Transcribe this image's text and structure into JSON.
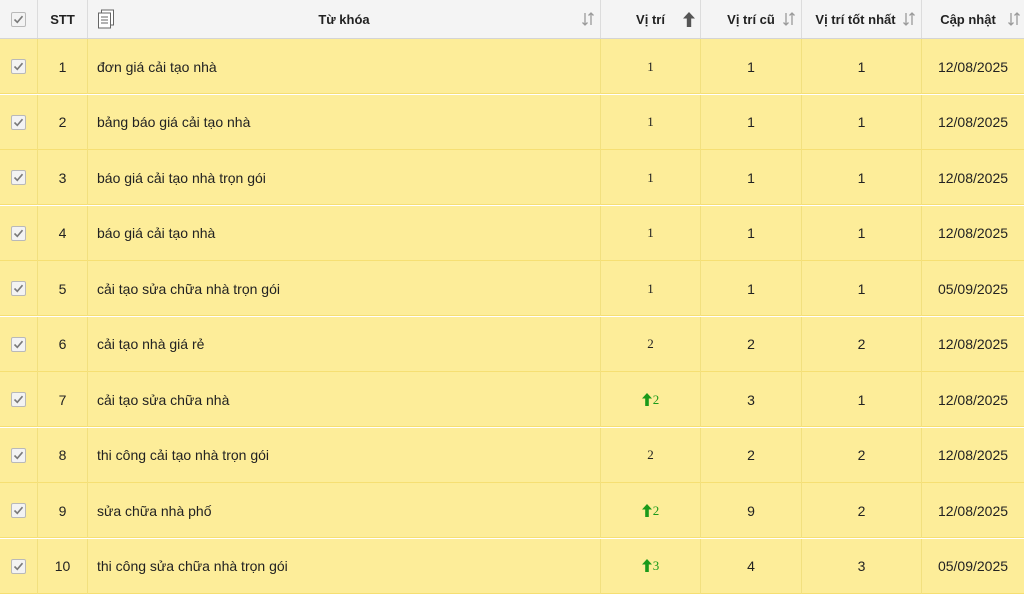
{
  "header": {
    "stt": "STT",
    "keyword": "Từ khóa",
    "position": "Vị trí",
    "old_position": "Vị trí cũ",
    "best_position": "Vị trí tốt nhất",
    "updated": "Cập nhật"
  },
  "rows": [
    {
      "stt": "1",
      "keyword": "đơn giá cải tạo nhà",
      "position": "1",
      "trend": "",
      "old": "1",
      "best": "1",
      "updated": "12/08/2025"
    },
    {
      "stt": "2",
      "keyword": "bảng báo giá cải tạo nhà",
      "position": "1",
      "trend": "",
      "old": "1",
      "best": "1",
      "updated": "12/08/2025"
    },
    {
      "stt": "3",
      "keyword": "báo giá cải tạo nhà trọn gói",
      "position": "1",
      "trend": "",
      "old": "1",
      "best": "1",
      "updated": "12/08/2025"
    },
    {
      "stt": "4",
      "keyword": "báo giá cải tạo nhà",
      "position": "1",
      "trend": "",
      "old": "1",
      "best": "1",
      "updated": "12/08/2025"
    },
    {
      "stt": "5",
      "keyword": "cải tạo sửa chữa nhà trọn gói",
      "position": "1",
      "trend": "",
      "old": "1",
      "best": "1",
      "updated": "05/09/2025"
    },
    {
      "stt": "6",
      "keyword": "cải tạo nhà giá rẻ",
      "position": "2",
      "trend": "",
      "old": "2",
      "best": "2",
      "updated": "12/08/2025"
    },
    {
      "stt": "7",
      "keyword": "cải tạo sửa chữa nhà",
      "position": "2",
      "trend": "up",
      "old": "3",
      "best": "1",
      "updated": "12/08/2025"
    },
    {
      "stt": "8",
      "keyword": "thi công cải tạo nhà trọn gói",
      "position": "2",
      "trend": "",
      "old": "2",
      "best": "2",
      "updated": "12/08/2025"
    },
    {
      "stt": "9",
      "keyword": "sửa chữa nhà phố",
      "position": "2",
      "trend": "up",
      "old": "9",
      "best": "2",
      "updated": "12/08/2025"
    },
    {
      "stt": "10",
      "keyword": "thi công sửa chữa nhà trọn gói",
      "position": "3",
      "trend": "up",
      "old": "4",
      "best": "3",
      "updated": "05/09/2025"
    }
  ],
  "colors": {
    "row_bg": "#fded99",
    "header_bg": "#f4f4f4",
    "up_arrow": "#1a9a1a"
  },
  "icons": {
    "select_all": "checkbox-icon",
    "keyword_col": "document-icon",
    "sort": "sort-icon",
    "sorted_asc": "arrow-up-icon",
    "trend_up": "green-arrow-up-icon"
  }
}
